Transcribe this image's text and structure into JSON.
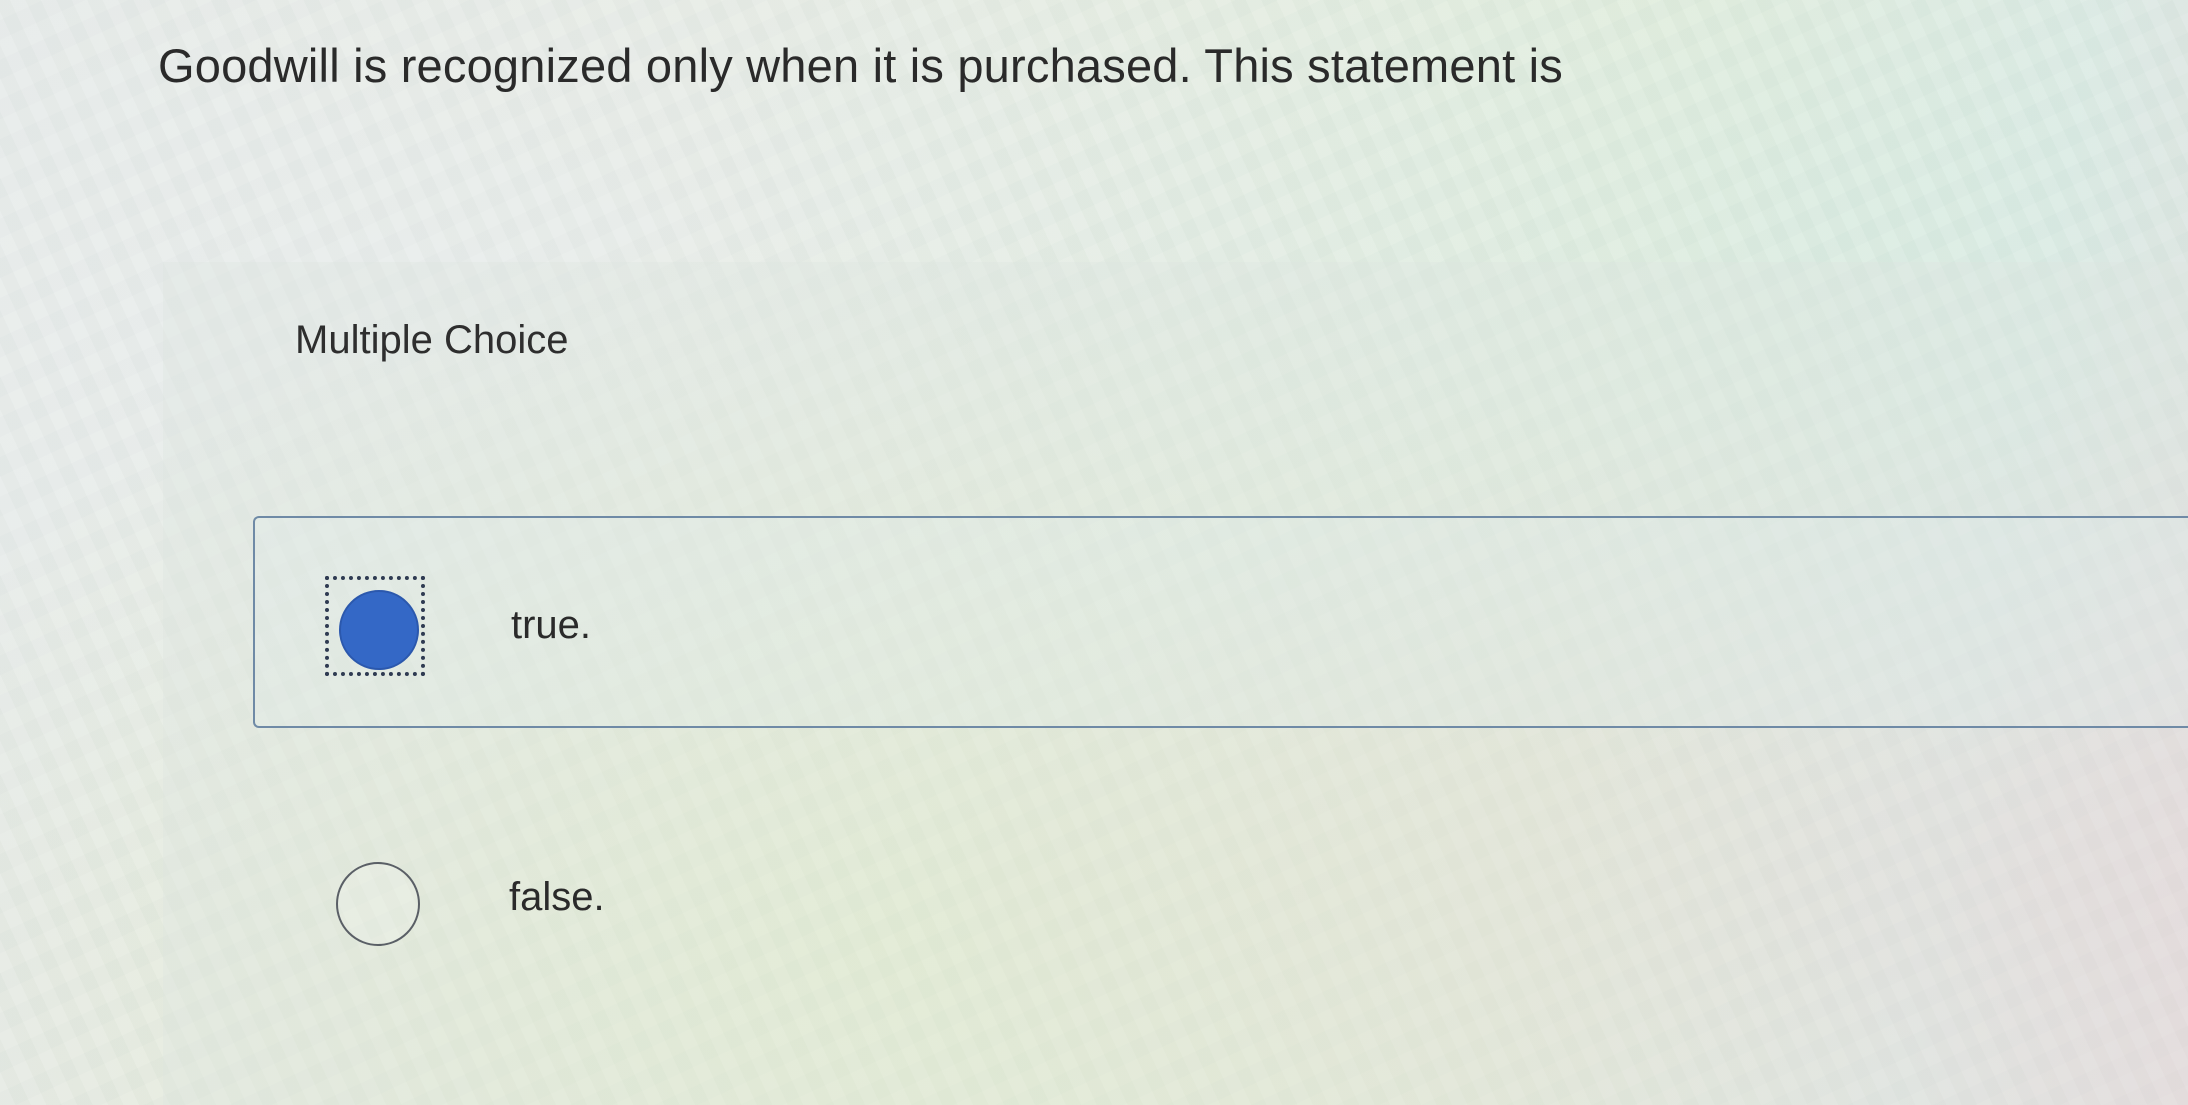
{
  "question": {
    "text": "Goodwill is recognized only when it is purchased. This statement is"
  },
  "answer_area": {
    "type_label": "Multiple Choice",
    "options": [
      {
        "label": "true.",
        "selected": true
      },
      {
        "label": "false.",
        "selected": false
      }
    ]
  },
  "colors": {
    "accent_selected": "#3468c6",
    "option_border": "#6f8aa6"
  }
}
